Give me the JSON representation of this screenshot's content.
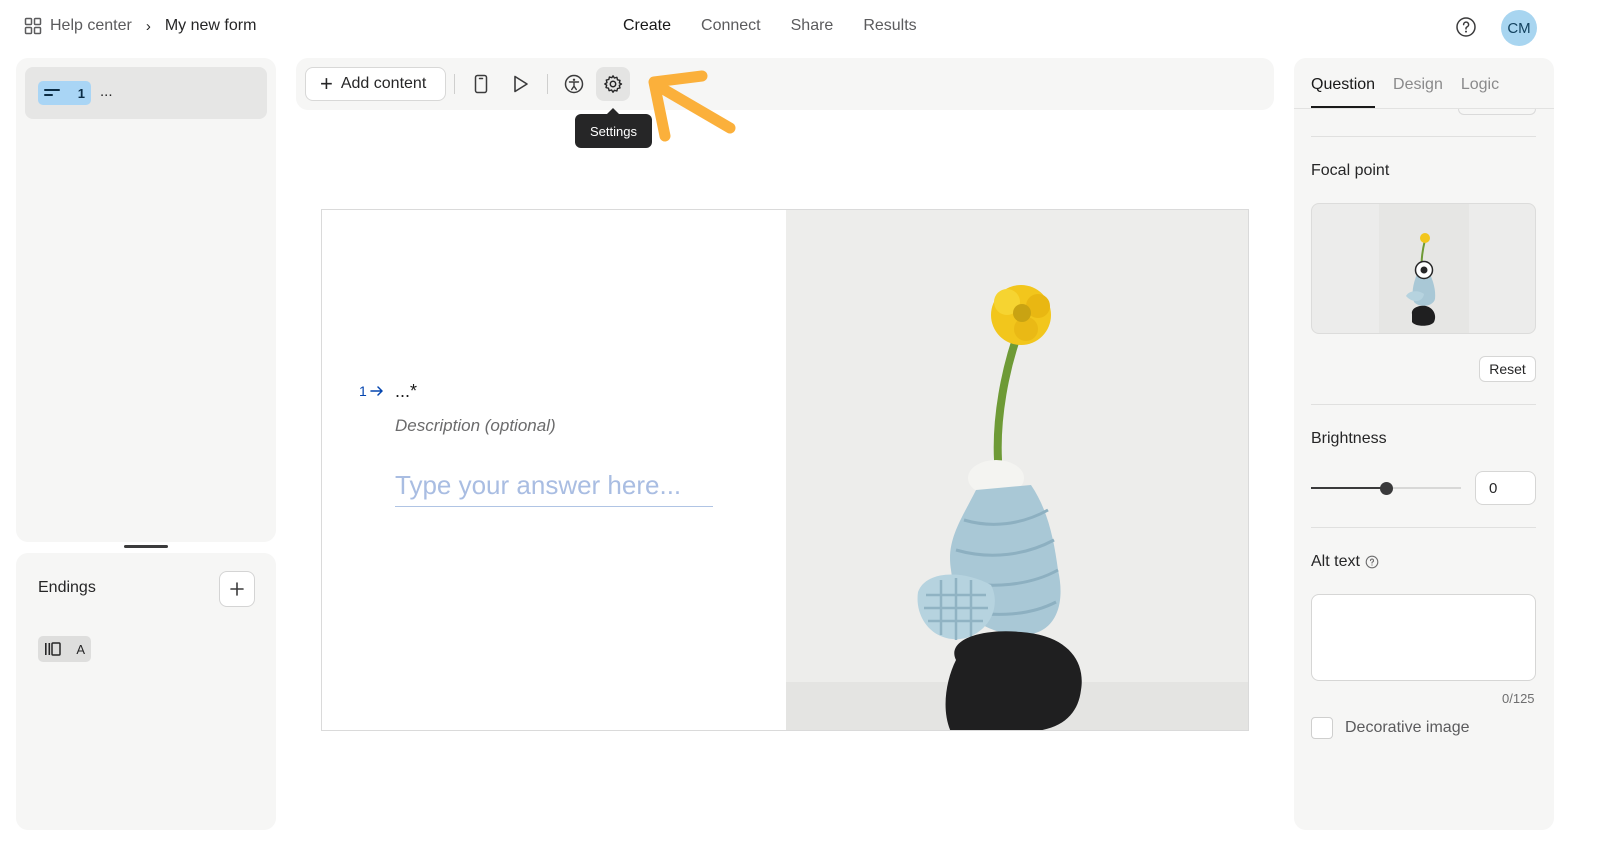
{
  "header": {
    "home_label": "Help center",
    "form_name": "My new form",
    "nav": [
      {
        "label": "Create",
        "active": true
      },
      {
        "label": "Connect",
        "active": false
      },
      {
        "label": "Share",
        "active": false
      },
      {
        "label": "Results",
        "active": false
      }
    ],
    "avatar_initials": "CM",
    "help_icon": "question-circle-icon"
  },
  "left_panel": {
    "questions": [
      {
        "number": "1",
        "label": "...",
        "icon": "short-text-icon"
      }
    ],
    "endings": {
      "title": "Endings",
      "items": [
        {
          "label": "A",
          "icon": "ending-icon"
        }
      ]
    }
  },
  "toolbar": {
    "add_content_label": "Add content",
    "tooltip": "Settings",
    "icons": [
      "mobile-preview-icon",
      "play-icon",
      "accessibility-icon",
      "gear-icon"
    ]
  },
  "canvas": {
    "question_number": "1",
    "question_title": "...*",
    "description_placeholder": "Description (optional)",
    "answer_placeholder": "Type your answer here..."
  },
  "right_panel": {
    "tabs": [
      {
        "label": "Question",
        "active": true
      },
      {
        "label": "Design",
        "active": false
      },
      {
        "label": "Logic",
        "active": false
      }
    ],
    "focal_point_label": "Focal point",
    "reset_label": "Reset",
    "brightness_label": "Brightness",
    "brightness_value": "0",
    "brightness_level": 0.5,
    "alt_text_label": "Alt text",
    "alt_text_counter": "0/125",
    "decorative_label": "Decorative image"
  },
  "colors": {
    "accent": "#0445af",
    "badge_blue": "#a9d5f5",
    "annotation_arrow": "#fbb03b"
  }
}
